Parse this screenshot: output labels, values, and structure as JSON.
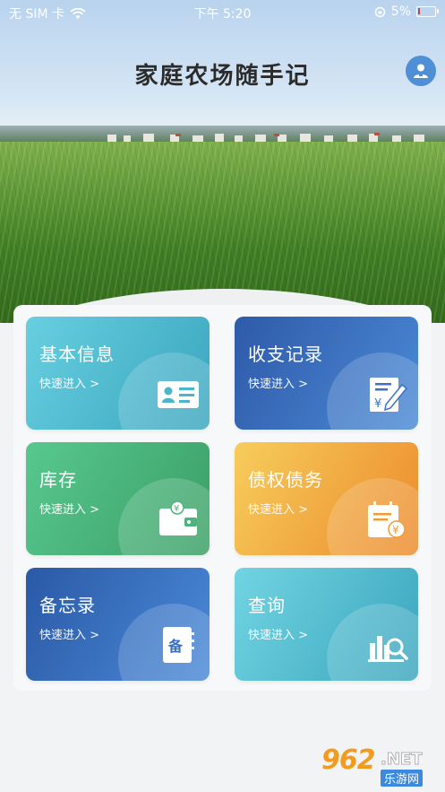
{
  "status_bar": {
    "carrier": "无 SIM 卡",
    "time": "下午 5:20",
    "battery": "5%",
    "battery_level": 0.05
  },
  "header": {
    "title": "家庭农场随手记"
  },
  "cards": [
    {
      "title": "基本信息",
      "subtitle": "快速进入 >",
      "icon": "id-card-icon"
    },
    {
      "title": "收支记录",
      "subtitle": "快速进入 >",
      "icon": "finance-note-icon"
    },
    {
      "title": "库存",
      "subtitle": "快速进入 >",
      "icon": "wallet-icon"
    },
    {
      "title": "债权债务",
      "subtitle": "快速进入 >",
      "icon": "debt-calendar-icon"
    },
    {
      "title": "备忘录",
      "subtitle": "快速进入 >",
      "icon": "memo-book-icon"
    },
    {
      "title": "查询",
      "subtitle": "快速进入 >",
      "icon": "chart-search-icon"
    }
  ],
  "memo_icon_char": "备",
  "yen_symbol": "¥",
  "watermark": {
    "number": "962",
    "net": ".NET",
    "cn": "乐游网"
  }
}
